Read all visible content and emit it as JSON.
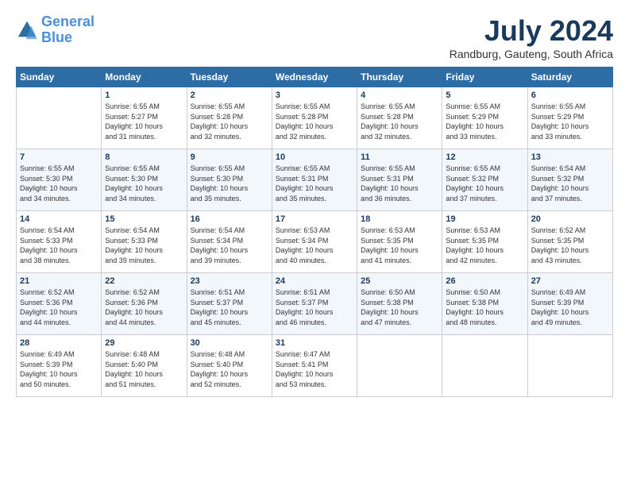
{
  "logo": {
    "line1": "General",
    "line2": "Blue"
  },
  "title": "July 2024",
  "location": "Randburg, Gauteng, South Africa",
  "days_header": [
    "Sunday",
    "Monday",
    "Tuesday",
    "Wednesday",
    "Thursday",
    "Friday",
    "Saturday"
  ],
  "weeks": [
    [
      {
        "num": "",
        "data": ""
      },
      {
        "num": "1",
        "data": "Sunrise: 6:55 AM\nSunset: 5:27 PM\nDaylight: 10 hours\nand 31 minutes."
      },
      {
        "num": "2",
        "data": "Sunrise: 6:55 AM\nSunset: 5:28 PM\nDaylight: 10 hours\nand 32 minutes."
      },
      {
        "num": "3",
        "data": "Sunrise: 6:55 AM\nSunset: 5:28 PM\nDaylight: 10 hours\nand 32 minutes."
      },
      {
        "num": "4",
        "data": "Sunrise: 6:55 AM\nSunset: 5:28 PM\nDaylight: 10 hours\nand 32 minutes."
      },
      {
        "num": "5",
        "data": "Sunrise: 6:55 AM\nSunset: 5:29 PM\nDaylight: 10 hours\nand 33 minutes."
      },
      {
        "num": "6",
        "data": "Sunrise: 6:55 AM\nSunset: 5:29 PM\nDaylight: 10 hours\nand 33 minutes."
      }
    ],
    [
      {
        "num": "7",
        "data": "Sunrise: 6:55 AM\nSunset: 5:30 PM\nDaylight: 10 hours\nand 34 minutes."
      },
      {
        "num": "8",
        "data": "Sunrise: 6:55 AM\nSunset: 5:30 PM\nDaylight: 10 hours\nand 34 minutes."
      },
      {
        "num": "9",
        "data": "Sunrise: 6:55 AM\nSunset: 5:30 PM\nDaylight: 10 hours\nand 35 minutes."
      },
      {
        "num": "10",
        "data": "Sunrise: 6:55 AM\nSunset: 5:31 PM\nDaylight: 10 hours\nand 35 minutes."
      },
      {
        "num": "11",
        "data": "Sunrise: 6:55 AM\nSunset: 5:31 PM\nDaylight: 10 hours\nand 36 minutes."
      },
      {
        "num": "12",
        "data": "Sunrise: 6:55 AM\nSunset: 5:32 PM\nDaylight: 10 hours\nand 37 minutes."
      },
      {
        "num": "13",
        "data": "Sunrise: 6:54 AM\nSunset: 5:32 PM\nDaylight: 10 hours\nand 37 minutes."
      }
    ],
    [
      {
        "num": "14",
        "data": "Sunrise: 6:54 AM\nSunset: 5:33 PM\nDaylight: 10 hours\nand 38 minutes."
      },
      {
        "num": "15",
        "data": "Sunrise: 6:54 AM\nSunset: 5:33 PM\nDaylight: 10 hours\nand 39 minutes."
      },
      {
        "num": "16",
        "data": "Sunrise: 6:54 AM\nSunset: 5:34 PM\nDaylight: 10 hours\nand 39 minutes."
      },
      {
        "num": "17",
        "data": "Sunrise: 6:53 AM\nSunset: 5:34 PM\nDaylight: 10 hours\nand 40 minutes."
      },
      {
        "num": "18",
        "data": "Sunrise: 6:53 AM\nSunset: 5:35 PM\nDaylight: 10 hours\nand 41 minutes."
      },
      {
        "num": "19",
        "data": "Sunrise: 6:53 AM\nSunset: 5:35 PM\nDaylight: 10 hours\nand 42 minutes."
      },
      {
        "num": "20",
        "data": "Sunrise: 6:52 AM\nSunset: 5:35 PM\nDaylight: 10 hours\nand 43 minutes."
      }
    ],
    [
      {
        "num": "21",
        "data": "Sunrise: 6:52 AM\nSunset: 5:36 PM\nDaylight: 10 hours\nand 44 minutes."
      },
      {
        "num": "22",
        "data": "Sunrise: 6:52 AM\nSunset: 5:36 PM\nDaylight: 10 hours\nand 44 minutes."
      },
      {
        "num": "23",
        "data": "Sunrise: 6:51 AM\nSunset: 5:37 PM\nDaylight: 10 hours\nand 45 minutes."
      },
      {
        "num": "24",
        "data": "Sunrise: 6:51 AM\nSunset: 5:37 PM\nDaylight: 10 hours\nand 46 minutes."
      },
      {
        "num": "25",
        "data": "Sunrise: 6:50 AM\nSunset: 5:38 PM\nDaylight: 10 hours\nand 47 minutes."
      },
      {
        "num": "26",
        "data": "Sunrise: 6:50 AM\nSunset: 5:38 PM\nDaylight: 10 hours\nand 48 minutes."
      },
      {
        "num": "27",
        "data": "Sunrise: 6:49 AM\nSunset: 5:39 PM\nDaylight: 10 hours\nand 49 minutes."
      }
    ],
    [
      {
        "num": "28",
        "data": "Sunrise: 6:49 AM\nSunset: 5:39 PM\nDaylight: 10 hours\nand 50 minutes."
      },
      {
        "num": "29",
        "data": "Sunrise: 6:48 AM\nSunset: 5:40 PM\nDaylight: 10 hours\nand 51 minutes."
      },
      {
        "num": "30",
        "data": "Sunrise: 6:48 AM\nSunset: 5:40 PM\nDaylight: 10 hours\nand 52 minutes."
      },
      {
        "num": "31",
        "data": "Sunrise: 6:47 AM\nSunset: 5:41 PM\nDaylight: 10 hours\nand 53 minutes."
      },
      {
        "num": "",
        "data": ""
      },
      {
        "num": "",
        "data": ""
      },
      {
        "num": "",
        "data": ""
      }
    ]
  ]
}
